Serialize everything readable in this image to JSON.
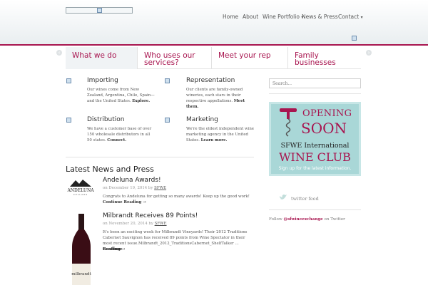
{
  "header": {
    "nav": {
      "home": "Home",
      "about": "About",
      "wine_portfolio": "Wine Portfolio",
      "news_press": "News & Press",
      "contact": "Contact"
    }
  },
  "tabs": [
    {
      "label": "What we do"
    },
    {
      "label": "Who uses our services?"
    },
    {
      "label": "Meet your rep"
    },
    {
      "label": "Family businesses"
    }
  ],
  "services": [
    {
      "title": "Importing",
      "text": "Our wines come from New Zealand, Argentina, Chile, Spain—and the United States.",
      "link": "Explore."
    },
    {
      "title": "Representation",
      "text": "Our clients are family-owned wineries, each stars in their respective appellations.",
      "link": "Meet them."
    },
    {
      "title": "Distribution",
      "text": "We have a customer base of over 150 wholesale distributors in all 50 states.",
      "link": "Connect."
    },
    {
      "title": "Marketing",
      "text": "We're the oldest independent wine marketing agency in the United States.",
      "link": "Learn more."
    }
  ],
  "news": {
    "heading": "Latest News and Press",
    "posts": [
      {
        "title": "Andeluna Awards!",
        "date_prefix": "on December 19, 2014 by",
        "author": "SFWE",
        "body": "Congrats to Andeluna for getting so many awards! Keep up the good work!",
        "more": "Continue Reading →",
        "logo_text": "ANDELUNA",
        "logo_sub": "CELLARS"
      },
      {
        "title": "Milbrandt Receives 89 Points!",
        "date_prefix": "on November 20, 2014 by",
        "author": "SFWE",
        "body": "It's been an exciting week for Milbrandt Vineyards! Their 2012 Traditions Cabernet Sauvignon has received 89 points from Wine Spectator in their most recent issue.Milbrandt_2012_TraditionsCabernet_ShelfTalker …",
        "more_inline": "Continue",
        "more": "Reading →",
        "label_text": "milbrandt"
      }
    ]
  },
  "sidebar": {
    "search_placeholder": "Search...",
    "ad": {
      "opening": "OPENING",
      "soon": "SOON",
      "sfwe": "SFWE International",
      "wine_club": "WINE CLUB",
      "signup": "Sign up for the latest information."
    },
    "twitter_label": "twitter feed",
    "follow_prefix": "Follow",
    "follow_handle": "@sfwineexchange",
    "follow_suffix": "on Twitter"
  },
  "colors": {
    "accent": "#a8154f",
    "ad_bg": "#a9d7d7"
  }
}
